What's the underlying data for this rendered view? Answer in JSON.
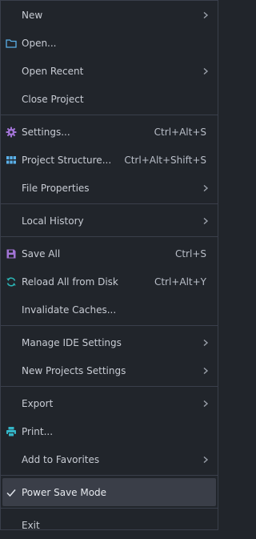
{
  "colors": {
    "background": "#21252b",
    "text": "#c8ccd4",
    "separator": "#3a3f4b",
    "selected_bg": "#3a3e48",
    "icon_blue": "#5ab0e8",
    "icon_purple": "#a274d6",
    "icon_cyan": "#2bb3b3",
    "icon_teal": "#34b5c7"
  },
  "menu": {
    "new": {
      "label": "New",
      "mnemonic_index": 0
    },
    "open": {
      "label": "Open...",
      "icon": "folder-icon"
    },
    "open_recent": {
      "label": "Open Recent"
    },
    "close_project": {
      "label": "Close Project"
    },
    "settings": {
      "label": "Settings...",
      "shortcut": "Ctrl+Alt+S",
      "icon": "gear-icon"
    },
    "project_structure": {
      "label": "Project Structure...",
      "shortcut": "Ctrl+Alt+Shift+S",
      "icon": "grid-icon"
    },
    "file_properties": {
      "label": "File Properties"
    },
    "local_history": {
      "label": "Local History"
    },
    "save_all": {
      "label": "Save All",
      "shortcut": "Ctrl+S",
      "icon": "save-icon"
    },
    "reload_all": {
      "label": "Reload All from Disk",
      "shortcut": "Ctrl+Alt+Y",
      "icon": "refresh-icon"
    },
    "invalidate_caches": {
      "label": "Invalidate Caches..."
    },
    "manage_ide_settings": {
      "label": "Manage IDE Settings"
    },
    "new_projects_settings": {
      "label": "New Projects Settings"
    },
    "export": {
      "label": "Export"
    },
    "print": {
      "label": "Print...",
      "icon": "printer-icon"
    },
    "add_to_favorites": {
      "label": "Add to Favorites"
    },
    "power_save_mode": {
      "label": "Power Save Mode",
      "checked": true,
      "icon": "checkmark-icon"
    },
    "exit": {
      "label": "Exit"
    }
  }
}
